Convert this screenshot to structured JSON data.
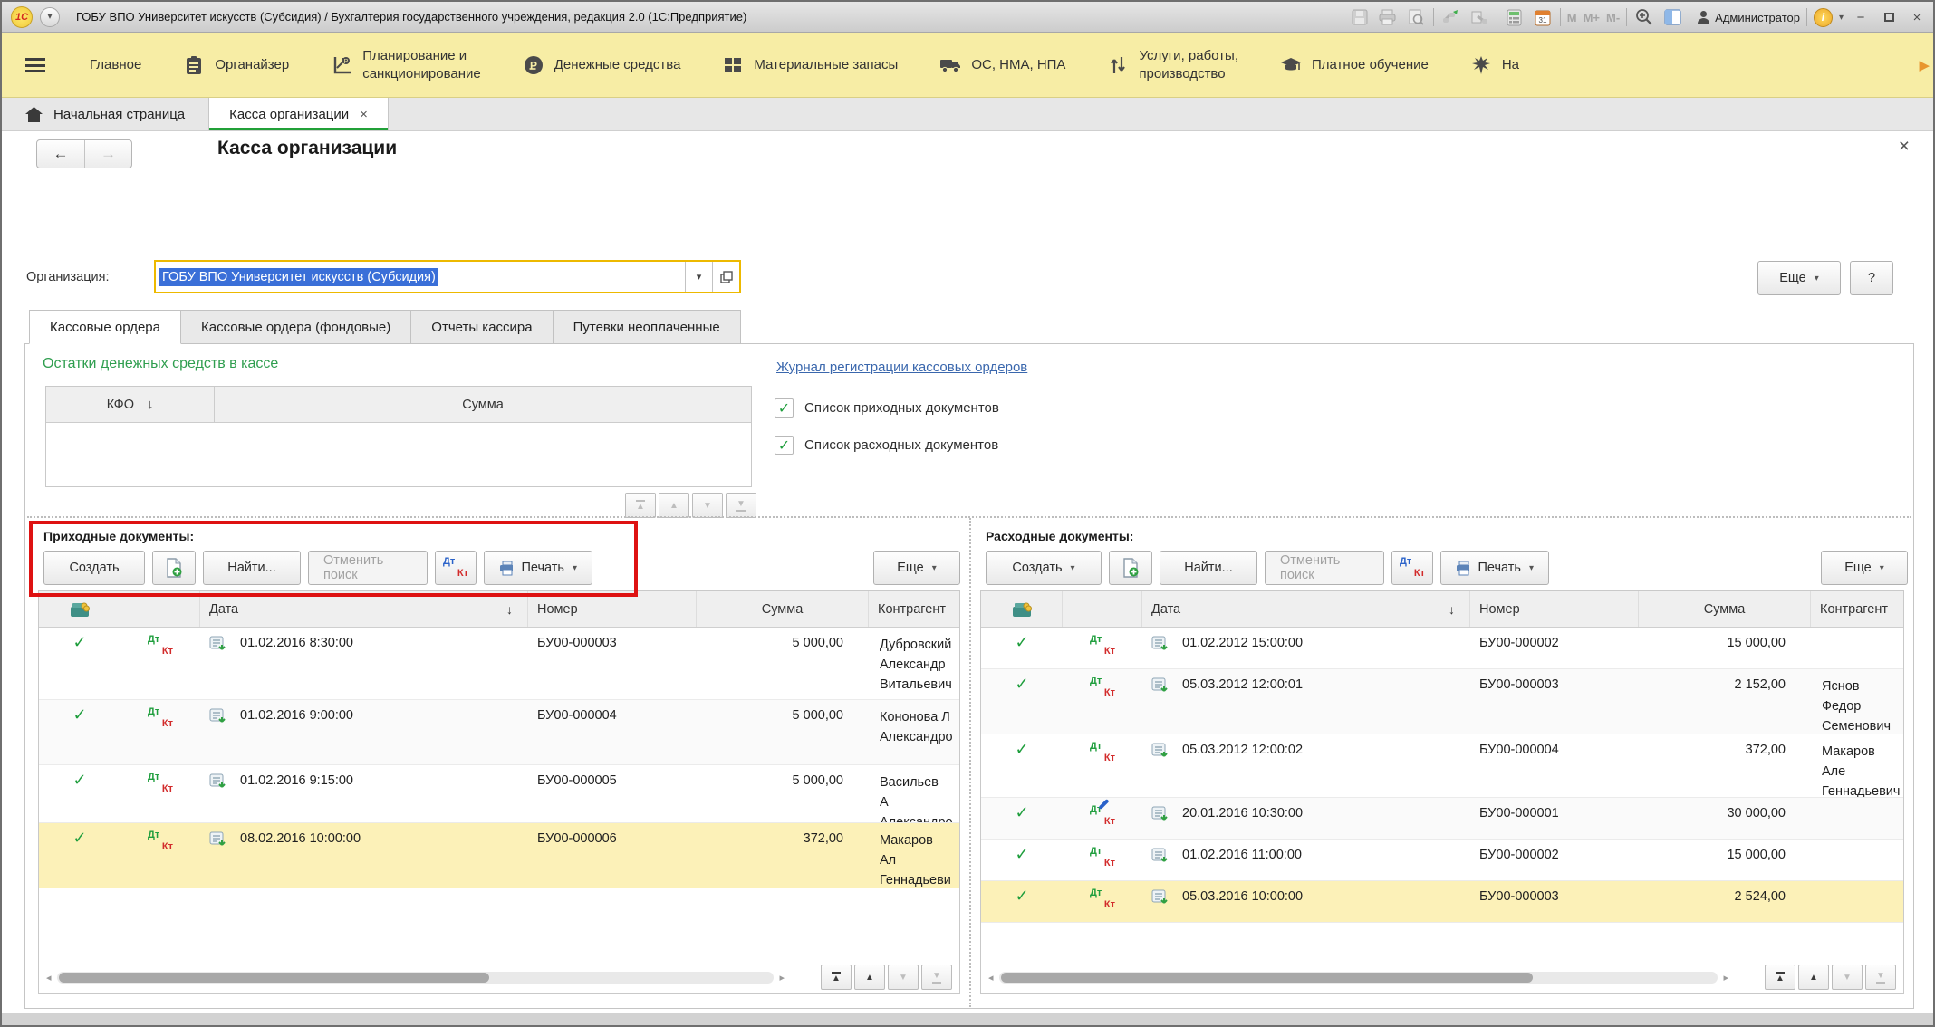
{
  "titlebar": {
    "title": "ГОБУ ВПО Университет искусств (Субсидия) / Бухгалтерия государственного учреждения, редакция 2.0  (1С:Предприятие)",
    "memory": [
      "M",
      "M+",
      "M-"
    ],
    "user": "Администратор"
  },
  "menubar": {
    "items": [
      "Главное",
      "Органайзер",
      "Планирование и\nсанкционирование",
      "Денежные средства",
      "Материальные запасы",
      "ОС, НМА, НПА",
      "Услуги, работы,\nпроизводство",
      "Платное обучение",
      "На"
    ]
  },
  "apptabs": {
    "home": "Начальная страница",
    "current": "Касса организации"
  },
  "page": {
    "title": "Касса организации",
    "org_label": "Организация:",
    "org_value": "ГОБУ ВПО Университет искусств (Субсидия)",
    "more": "Еще",
    "help": "?"
  },
  "section_tabs": [
    "Кассовые ордера",
    "Кассовые ордера (фондовые)",
    "Отчеты кассира",
    "Путевки неоплаченные"
  ],
  "balances": {
    "heading": "Остатки денежных средств в кассе",
    "col_kfo": "КФО",
    "col_sum": "Сумма",
    "journal_link": "Журнал регистрации кассовых ордеров",
    "chk_incoming": "Список приходных документов",
    "chk_outgoing": "Список расходных документов"
  },
  "labels": {
    "create": "Создать",
    "find": "Найти...",
    "cancel_search": "Отменить поиск",
    "print": "Печать",
    "more": "Еще",
    "dt": "Дт",
    "kt": "Кт"
  },
  "columns": {
    "date": "Дата",
    "number": "Номер",
    "sum": "Сумма",
    "contragent": "Контрагент"
  },
  "incoming": {
    "title": "Приходные документы:",
    "rows": [
      {
        "date": "01.02.2016 8:30:00",
        "number": "БУ00-000003",
        "sum": "5 000,00",
        "contragent": "Дубровский\nАлександр\nВитальевич"
      },
      {
        "date": "01.02.2016 9:00:00",
        "number": "БУ00-000004",
        "sum": "5 000,00",
        "contragent": "Кононова Л\nАлександро"
      },
      {
        "date": "01.02.2016 9:15:00",
        "number": "БУ00-000005",
        "sum": "5 000,00",
        "contragent": "Васильев А\nАлександро"
      },
      {
        "date": "08.02.2016 10:00:00",
        "number": "БУ00-000006",
        "sum": "372,00",
        "contragent": "Макаров Ал\nГеннадьеви"
      }
    ]
  },
  "outgoing": {
    "title": "Расходные документы:",
    "rows": [
      {
        "date": "01.02.2012 15:00:00",
        "number": "БУ00-000002",
        "sum": "15 000,00",
        "contragent": ""
      },
      {
        "date": "05.03.2012 12:00:01",
        "number": "БУ00-000003",
        "sum": "2 152,00",
        "contragent": "Яснов Федор\nСеменович"
      },
      {
        "date": "05.03.2012 12:00:02",
        "number": "БУ00-000004",
        "sum": "372,00",
        "contragent": "Макаров Але\nГеннадьевич"
      },
      {
        "date": "20.01.2016 10:30:00",
        "number": "БУ00-000001",
        "sum": "30 000,00",
        "contragent": ""
      },
      {
        "date": "01.02.2016 11:00:00",
        "number": "БУ00-000002",
        "sum": "15 000,00",
        "contragent": ""
      },
      {
        "date": "05.03.2016 10:00:00",
        "number": "БУ00-000003",
        "sum": "2 524,00",
        "contragent": ""
      }
    ]
  }
}
